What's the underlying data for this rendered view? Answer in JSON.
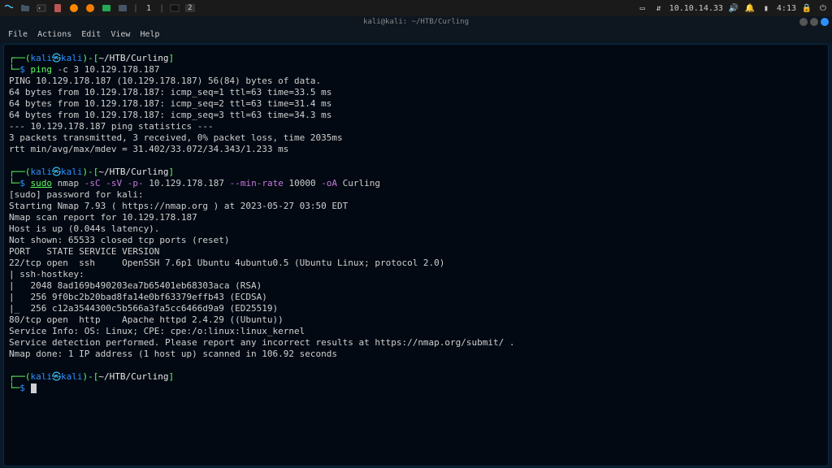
{
  "panel": {
    "workspace": "1",
    "badge": "2",
    "ip": "10.10.14.33",
    "time": "4:13",
    "title": "kali@kali: ~/HTB/Curling"
  },
  "menu": {
    "file": "File",
    "actions": "Actions",
    "edit": "Edit",
    "view": "View",
    "help": "Help"
  },
  "prompt": {
    "open": "┌──(",
    "user": "kali",
    "at": "㉿",
    "host": "kali",
    "closeuser": ")",
    "dash": "-[",
    "path": "~/HTB/Curling",
    "closepath": "]",
    "line2": "└─",
    "dollar": "$"
  },
  "cmd1": {
    "ping": "ping",
    "args": " -c 3 10.129.178.187"
  },
  "ping_out": [
    "PING 10.129.178.187 (10.129.178.187) 56(84) bytes of data.",
    "64 bytes from 10.129.178.187: icmp_seq=1 ttl=63 time=33.5 ms",
    "64 bytes from 10.129.178.187: icmp_seq=2 ttl=63 time=31.4 ms",
    "64 bytes from 10.129.178.187: icmp_seq=3 ttl=63 time=34.3 ms",
    "",
    "--- 10.129.178.187 ping statistics ---",
    "3 packets transmitted, 3 received, 0% packet loss, time 2035ms",
    "rtt min/avg/max/mdev = 31.402/33.072/34.343/1.233 ms"
  ],
  "cmd2": {
    "sudo": "sudo",
    "nmap": " nmap ",
    "f_sc": "-sC",
    "sp1": " ",
    "f_sv": "-sV",
    "sp2": " ",
    "f_p": "-p-",
    "mid": " 10.129.178.187 ",
    "f_rate": "--min-rate",
    "rate": " 10000 ",
    "f_oa": "-oA",
    "out": " Curling"
  },
  "nmap_out": [
    "[sudo] password for kali:",
    "Starting Nmap 7.93 ( https://nmap.org ) at 2023-05-27 03:50 EDT",
    "Nmap scan report for 10.129.178.187",
    "Host is up (0.044s latency).",
    "Not shown: 65533 closed tcp ports (reset)",
    "PORT   STATE SERVICE VERSION",
    "22/tcp open  ssh     OpenSSH 7.6p1 Ubuntu 4ubuntu0.5 (Ubuntu Linux; protocol 2.0)",
    "| ssh-hostkey:",
    "|   2048 8ad169b490203ea7b65401eb68303aca (RSA)",
    "|   256 9f0bc2b20bad8fa14e0bf63379effb43 (ECDSA)",
    "|_  256 c12a3544300c5b566a3fa5cc6466d9a9 (ED25519)",
    "80/tcp open  http    Apache httpd 2.4.29 ((Ubuntu))",
    "Service Info: OS: Linux; CPE: cpe:/o:linux:linux_kernel",
    "",
    "Service detection performed. Please report any incorrect results at https://nmap.org/submit/ .",
    "Nmap done: 1 IP address (1 host up) scanned in 106.92 seconds"
  ]
}
